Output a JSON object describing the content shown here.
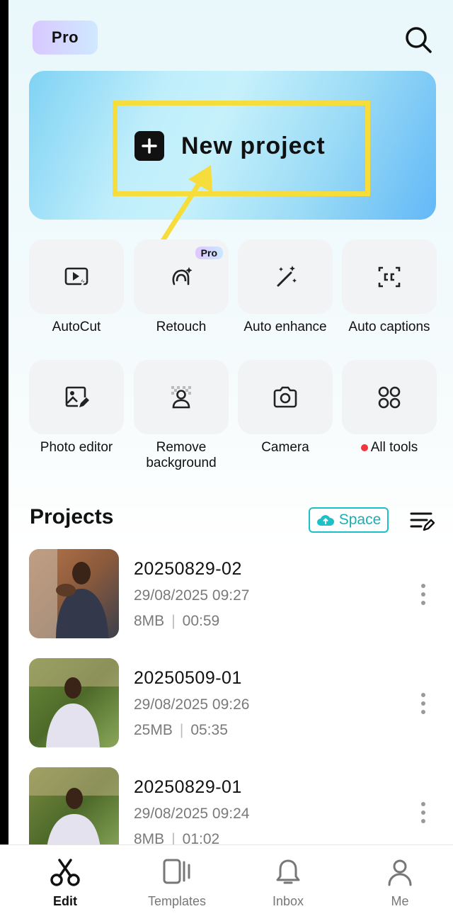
{
  "header": {
    "pro_label": "Pro"
  },
  "hero": {
    "new_project_label": "New project"
  },
  "tools": [
    {
      "label": "AutoCut",
      "icon": "autocut-icon"
    },
    {
      "label": "Retouch",
      "icon": "retouch-icon",
      "badge": "Pro"
    },
    {
      "label": "Auto enhance",
      "icon": "magic-wand-icon"
    },
    {
      "label": "Auto captions",
      "icon": "captions-icon"
    },
    {
      "label": "Photo editor",
      "icon": "photo-edit-icon"
    },
    {
      "label": "Remove background",
      "icon": "remove-bg-icon"
    },
    {
      "label": "Camera",
      "icon": "camera-icon"
    },
    {
      "label": "All tools",
      "icon": "grid-icon"
    }
  ],
  "projects": {
    "title": "Projects",
    "space_label": "Space",
    "items": [
      {
        "name": "20250829-02",
        "date": "29/08/2025 09:27",
        "size": "8MB",
        "duration": "00:59"
      },
      {
        "name": "20250509-01",
        "date": "29/08/2025 09:26",
        "size": "25MB",
        "duration": "05:35"
      },
      {
        "name": "20250829-01",
        "date": "29/08/2025 09:24",
        "size": "8MB",
        "duration": "01:02"
      }
    ]
  },
  "nav": [
    {
      "label": "Edit"
    },
    {
      "label": "Templates"
    },
    {
      "label": "Inbox"
    },
    {
      "label": "Me"
    }
  ],
  "colors": {
    "highlight": "#f6dd3c",
    "accent": "#1ec0c7",
    "notification_dot": "#f0353c"
  }
}
